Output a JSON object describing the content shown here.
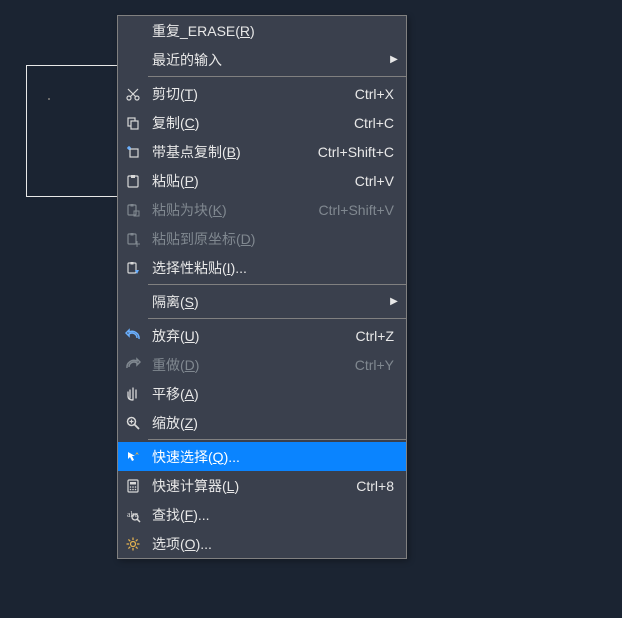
{
  "menu": {
    "items": [
      {
        "id": "repeat-erase",
        "icon": null,
        "label_pre": "重复_ERASE(",
        "hotkey": "R",
        "label_post": ")",
        "shortcut": "",
        "submenu": false,
        "disabled": false
      },
      {
        "id": "recent-input",
        "icon": null,
        "label_pre": "最近的输入",
        "hotkey": "",
        "label_post": "",
        "shortcut": "",
        "submenu": true,
        "disabled": false
      },
      {
        "sep": true
      },
      {
        "id": "cut",
        "icon": "scissors",
        "label_pre": "剪切(",
        "hotkey": "T",
        "label_post": ")",
        "shortcut": "Ctrl+X",
        "submenu": false,
        "disabled": false
      },
      {
        "id": "copy",
        "icon": "copy",
        "label_pre": "复制(",
        "hotkey": "C",
        "label_post": ")",
        "shortcut": "Ctrl+C",
        "submenu": false,
        "disabled": false
      },
      {
        "id": "copy-base",
        "icon": "copy-base",
        "label_pre": "带基点复制(",
        "hotkey": "B",
        "label_post": ")",
        "shortcut": "Ctrl+Shift+C",
        "submenu": false,
        "disabled": false
      },
      {
        "id": "paste",
        "icon": "paste",
        "label_pre": "粘贴(",
        "hotkey": "P",
        "label_post": ")",
        "shortcut": "Ctrl+V",
        "submenu": false,
        "disabled": false
      },
      {
        "id": "paste-block",
        "icon": "paste-block",
        "label_pre": "粘贴为块(",
        "hotkey": "K",
        "label_post": ")",
        "shortcut": "Ctrl+Shift+V",
        "submenu": false,
        "disabled": true
      },
      {
        "id": "paste-orig",
        "icon": "paste-orig",
        "label_pre": "粘贴到原坐标(",
        "hotkey": "D",
        "label_post": ")",
        "shortcut": "",
        "submenu": false,
        "disabled": true
      },
      {
        "id": "paste-special",
        "icon": "paste-special",
        "label_pre": "选择性粘贴(",
        "hotkey": "I",
        "label_post": ")...",
        "shortcut": "",
        "submenu": false,
        "disabled": false
      },
      {
        "sep": true
      },
      {
        "id": "isolate",
        "icon": null,
        "label_pre": "隔离(",
        "hotkey": "S",
        "label_post": ")",
        "shortcut": "",
        "submenu": true,
        "disabled": false
      },
      {
        "sep": true
      },
      {
        "id": "undo",
        "icon": "undo",
        "label_pre": "放弃(",
        "hotkey": "U",
        "label_post": ")",
        "shortcut": "Ctrl+Z",
        "submenu": false,
        "disabled": false
      },
      {
        "id": "redo",
        "icon": "redo",
        "label_pre": "重做(",
        "hotkey": "D",
        "label_post": ")",
        "shortcut": "Ctrl+Y",
        "submenu": false,
        "disabled": true
      },
      {
        "id": "pan",
        "icon": "pan",
        "label_pre": "平移(",
        "hotkey": "A",
        "label_post": ")",
        "shortcut": "",
        "submenu": false,
        "disabled": false
      },
      {
        "id": "zoom",
        "icon": "zoom",
        "label_pre": "缩放(",
        "hotkey": "Z",
        "label_post": ")",
        "shortcut": "",
        "submenu": false,
        "disabled": false
      },
      {
        "sep": true
      },
      {
        "id": "quick-select",
        "icon": "quick-select",
        "label_pre": "快速选择(",
        "hotkey": "Q",
        "label_post": ")...",
        "shortcut": "",
        "submenu": false,
        "disabled": false,
        "selected": true
      },
      {
        "id": "quick-calc",
        "icon": "calculator",
        "label_pre": "快速计算器(",
        "hotkey": "L",
        "label_post": ")",
        "shortcut": "Ctrl+8",
        "submenu": false,
        "disabled": false
      },
      {
        "id": "find",
        "icon": "find",
        "label_pre": "查找(",
        "hotkey": "F",
        "label_post": ")...",
        "shortcut": "",
        "submenu": false,
        "disabled": false
      },
      {
        "id": "options",
        "icon": "gear",
        "label_pre": "选项(",
        "hotkey": "O",
        "label_post": ")...",
        "shortcut": "",
        "submenu": false,
        "disabled": false
      }
    ]
  }
}
